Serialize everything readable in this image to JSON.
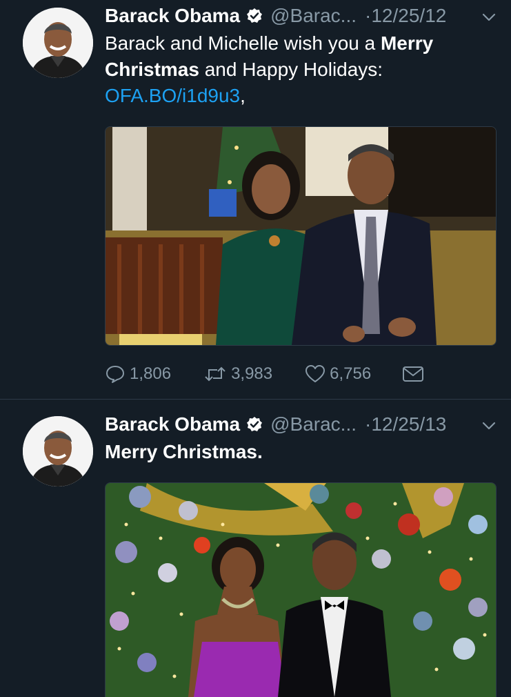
{
  "tweets": [
    {
      "name": "Barack Obama",
      "handle": "@Barac...",
      "dot": "·",
      "date": "12/25/12",
      "text_parts": {
        "a": "Barack and Michelle wish you a ",
        "b": "Merry",
        "c": "Christmas",
        "d": " and Happy Holidays:",
        "link": "OFA.BO/i1d9u3",
        "e": ","
      },
      "actions": {
        "replies": "1,806",
        "retweets": "3,983",
        "likes": "6,756"
      },
      "icons": [
        "reply-icon",
        "retweet-icon",
        "heart-icon",
        "message-icon"
      ]
    },
    {
      "name": "Barack Obama",
      "handle": "@Barac...",
      "dot": "·",
      "date": "12/25/13",
      "text": "Merry Christmas."
    }
  ],
  "colors": {
    "background": "#141d26",
    "link": "#1da1f2",
    "muted": "#8899a6",
    "verified": "#ffffff"
  }
}
